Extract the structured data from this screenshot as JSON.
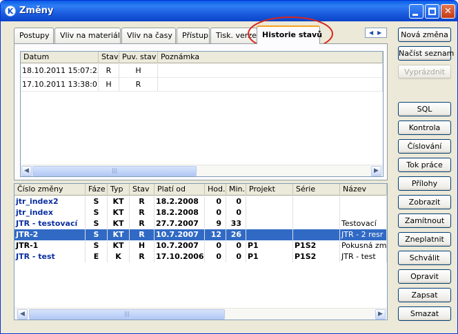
{
  "window": {
    "title": "Změny",
    "app_icon": "K"
  },
  "tabs": [
    "Postupy",
    "Vliv na materiál",
    "Vliv na časy",
    "Přístup",
    "Tisk. verze",
    "Historie stavů"
  ],
  "active_tab": "Historie stavů",
  "history": {
    "columns": [
      "Datum",
      "Stav",
      "Puv. stav",
      "Poznámka"
    ],
    "rows": [
      [
        "18.10.2011 15:07:23",
        "R",
        "H",
        ""
      ],
      [
        "17.10.2011 13:38:07",
        "H",
        "R",
        ""
      ]
    ]
  },
  "changes": {
    "columns": [
      "Číslo změny",
      "Fáze",
      "Typ",
      "Stav",
      "Platí od",
      "Hod.",
      "Min.",
      "Projekt",
      "Série",
      "Název"
    ],
    "rows": [
      [
        "jtr_index2",
        "S",
        "KT",
        "R",
        "18.2.2008",
        "0",
        "0",
        "",
        "",
        ""
      ],
      [
        "jtr_index",
        "S",
        "KT",
        "R",
        "18.2.2008",
        "0",
        "0",
        "",
        "",
        ""
      ],
      [
        "JTR - testovací",
        "S",
        "KT",
        "R",
        "27.7.2007",
        "9",
        "33",
        "",
        "",
        "Testovací"
      ],
      [
        "JTR-2",
        "S",
        "KT",
        "R",
        "10.7.2007",
        "12",
        "26",
        "",
        "",
        "JTR - 2 resr"
      ],
      [
        "JTR-1",
        "S",
        "KT",
        "H",
        "10.7.2007",
        "0",
        "0",
        "P1",
        "P1S2",
        "Pokusná změr"
      ],
      [
        "JTR - test",
        "E",
        "K",
        "R",
        "17.10.2006",
        "0",
        "0",
        "P1",
        "P1S2",
        "JTR - test"
      ]
    ],
    "selected_index": 3,
    "blue_rows": [
      0,
      1,
      2,
      5
    ]
  },
  "buttons": [
    "Nová změna",
    "Načíst seznam",
    "Vyprázdnit",
    "SQL",
    "Kontrola",
    "Číslování",
    "Tok práce",
    "Přílohy",
    "Zobrazit",
    "Zamítnout",
    "Zneplatnit",
    "Schválit",
    "Opravit",
    "Zapsat",
    "Smazat"
  ],
  "disabled_buttons": [
    "Vyprázdnit"
  ],
  "colors": {
    "title_bar": "#0a5de6",
    "selection": "#316ac5",
    "active_tab_accent": "#f7a11a",
    "row_link_blue": "#0a2ea0"
  }
}
